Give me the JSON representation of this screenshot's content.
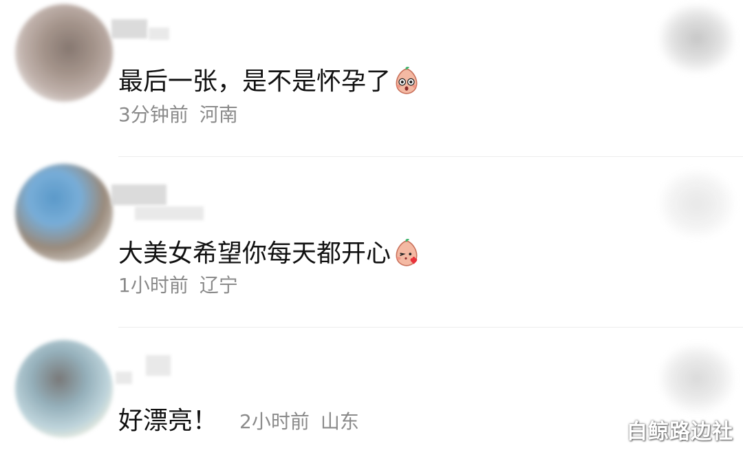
{
  "comments": [
    {
      "text": "最后一张，是不是怀孕了",
      "emoji": "peach-shocked-emoji",
      "time": "3分钟前",
      "location": "河南"
    },
    {
      "text": "大美女希望你每天都开心",
      "emoji": "peach-kiss-emoji",
      "time": "1小时前",
      "location": "辽宁"
    },
    {
      "text": "好漂亮！",
      "time": "2小时前",
      "location": "山东"
    }
  ],
  "watermark": "白鲸路边社",
  "colors": {
    "text": "#111111",
    "meta": "#8a8a8a",
    "divider": "#ececec",
    "background": "#ffffff"
  }
}
